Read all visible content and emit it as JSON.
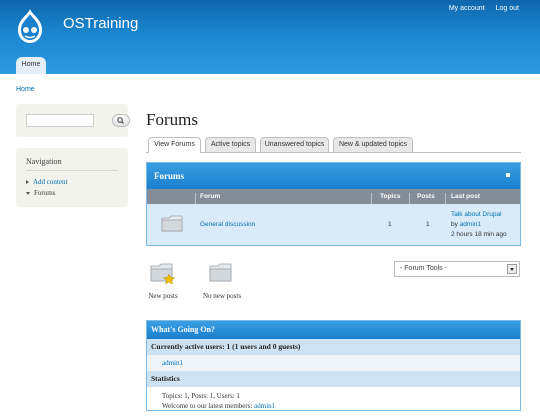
{
  "header": {
    "site_name": "OSTraining",
    "secondary_menu": [
      "My account",
      "Log out"
    ],
    "main_menu": {
      "home": "Home"
    }
  },
  "breadcrumb": "Home",
  "sidebar": {
    "search": {
      "value": "",
      "placeholder": ""
    },
    "navigation": {
      "title": "Navigation",
      "items": [
        {
          "label": "Add content",
          "link": true
        },
        {
          "label": "Forums",
          "link": false
        }
      ]
    }
  },
  "main": {
    "title": "Forums",
    "tabs": [
      {
        "label": "View Forums",
        "active": true
      },
      {
        "label": "Active topics",
        "active": false
      },
      {
        "label": "Unanswered topics",
        "active": false
      },
      {
        "label": "New & updated topics",
        "active": false
      }
    ],
    "forum_table": {
      "title": "Forums",
      "columns": {
        "forum": "Forum",
        "topics": "Topics",
        "posts": "Posts",
        "last_post": "Last post"
      },
      "rows": [
        {
          "name": "General discussion",
          "topics": "1",
          "posts": "1",
          "last_post_title": "Talk about Drupal",
          "last_post_by_prefix": "by",
          "last_post_author": "admin1",
          "last_post_time": "2 hours 18 min ago"
        }
      ]
    },
    "icon_legend": {
      "new_posts": "New posts",
      "no_new_posts": "No new posts"
    },
    "forum_tools": {
      "selected": "- Forum Tools -"
    },
    "whos_online": {
      "title": "What's Going On?",
      "active_users": "Currently active users: 1 (1 users and 0 guests)",
      "active_user_name": "admin1",
      "statistics_title": "Statistics",
      "statistics_line": "Topics: 1, Posts: 1, Users: 1",
      "latest_member_prefix": "Welcome to our latest members:",
      "latest_member": "admin1"
    }
  },
  "colors": {
    "header_top": "#0e66ad",
    "header_bottom": "#2e9ae0",
    "link": "#0071b3",
    "table_header": "#848d97",
    "row_bg": "#d9ebf8"
  }
}
